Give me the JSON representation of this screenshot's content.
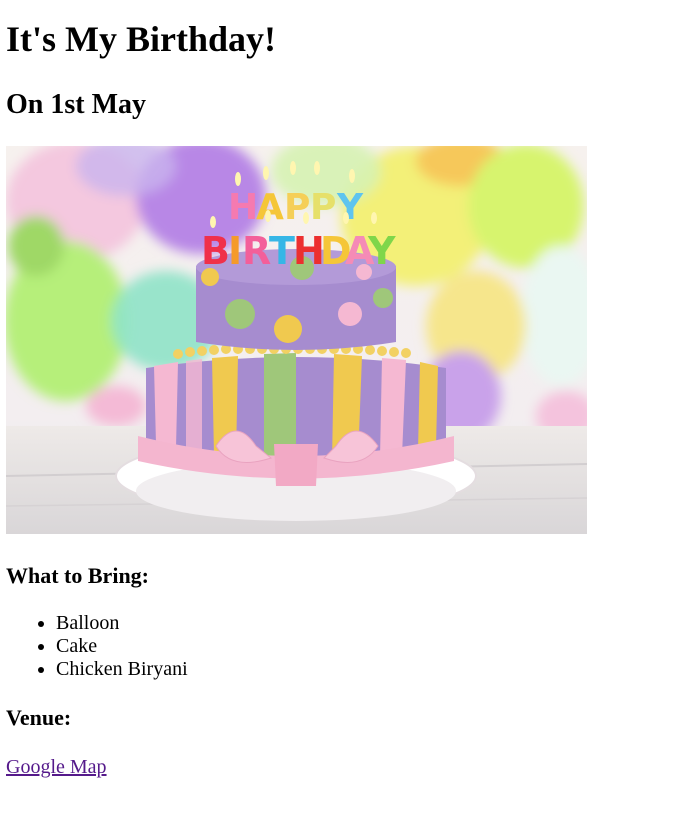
{
  "title": "It's My Birthday!",
  "subtitle": "On 1st May",
  "image": {
    "subject": "two-tier birthday cake with HAPPY BIRTHDAY candles and balloons",
    "candle_text_top": "HAPPY",
    "candle_text_bottom": "BIRTHDAY",
    "colors": {
      "balloon_purple": "#b887e6",
      "balloon_yellow": "#f3f078",
      "balloon_green": "#b6ef7a",
      "cake_purple": "#a68ccf",
      "stripe_yellow": "#f0c94f",
      "stripe_pink": "#f5b8d2",
      "stripe_green": "#9fc77a",
      "ribbon_pink": "#f4b6cf"
    }
  },
  "bring": {
    "heading": "What to Bring:",
    "items": [
      "Balloon",
      "Cake",
      "Chicken Biryani"
    ]
  },
  "venue": {
    "heading": "Venue:",
    "link_text": "Google Map"
  },
  "colors": {
    "visited_link": "#551a8b",
    "text": "#000000",
    "background": "#ffffff"
  }
}
